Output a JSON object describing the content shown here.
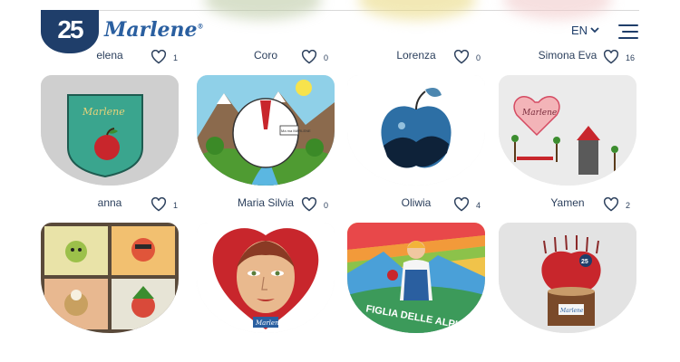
{
  "header": {
    "logo_number": "25",
    "brand_name": "Marlene",
    "brand_mark": "®",
    "language": "EN"
  },
  "rows": [
    {
      "cards": [
        {
          "name": "elena",
          "likes": "1"
        },
        {
          "name": "Coro",
          "likes": "0"
        },
        {
          "name": "Lorenza",
          "likes": "0"
        },
        {
          "name": "Simona Eva",
          "likes": "16"
        }
      ]
    },
    {
      "cards": [
        {
          "name": "anna",
          "likes": "1"
        },
        {
          "name": "Maria Silvia",
          "likes": "0"
        },
        {
          "name": "Oliwia",
          "likes": "4"
        },
        {
          "name": "Yamen",
          "likes": "2"
        }
      ]
    }
  ],
  "artwork_text": {
    "card1_shield": "Marlene",
    "card2_badge": "Ma ma MARLENE",
    "card4_drawing": "Marlene",
    "card6_tag": "Marlene",
    "card7_banner": "FIGLIA DELLE ALPI",
    "card8_apple": "25",
    "card8_tag": "Marlene"
  },
  "colors": {
    "brand_navy": "#1f3e6a",
    "brand_blue": "#2a5fa0",
    "apple_red": "#c8262c"
  },
  "icons": [
    "heart-icon",
    "chevron-down-icon",
    "hamburger-menu-icon"
  ]
}
